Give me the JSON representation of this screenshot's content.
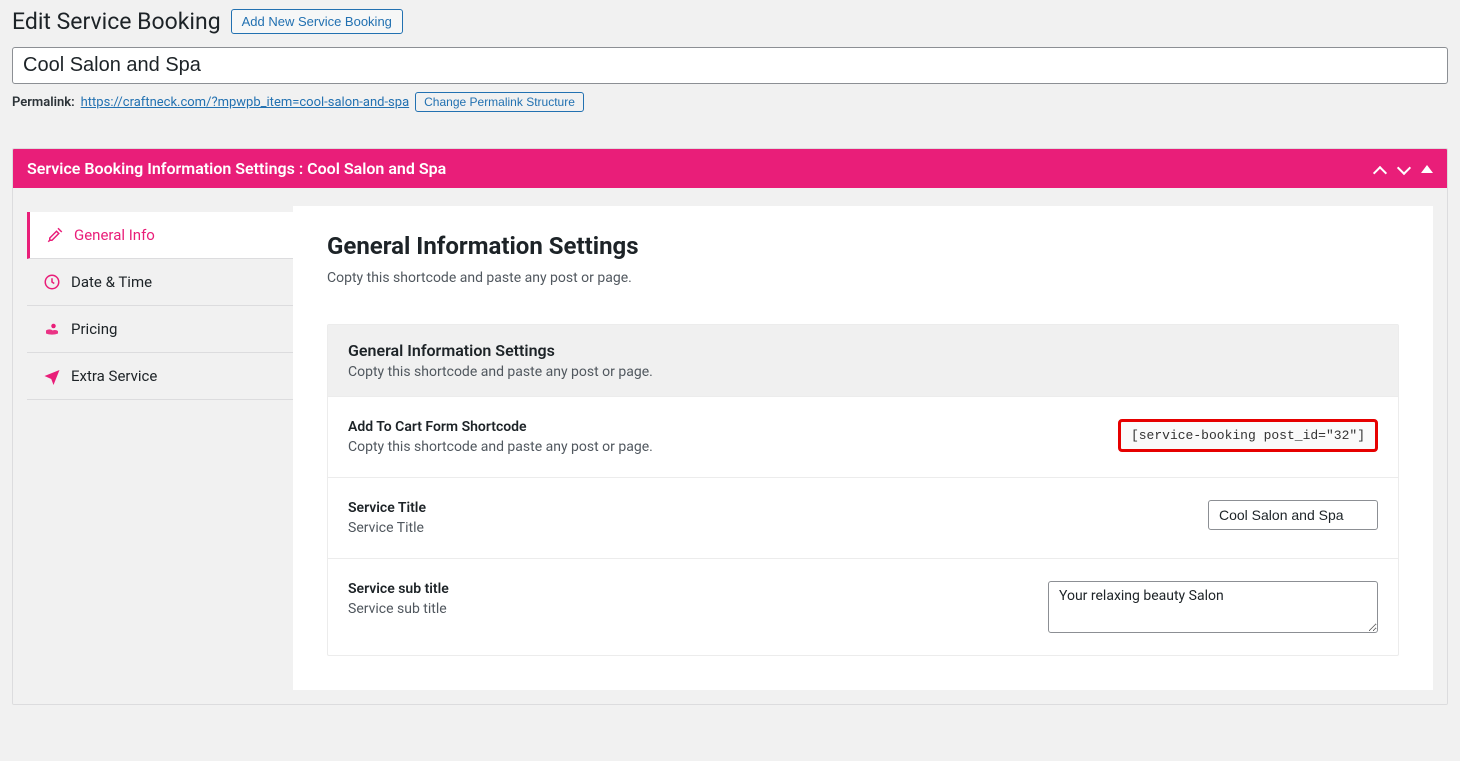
{
  "header": {
    "title": "Edit Service Booking",
    "add_new_label": "Add New Service Booking"
  },
  "post": {
    "title": "Cool Salon and Spa",
    "permalink_label": "Permalink:",
    "permalink_url": "https://craftneck.com/?mpwpb_item=cool-salon-and-spa",
    "change_permalink_label": "Change Permalink Structure"
  },
  "panel": {
    "title": "Service Booking Information Settings : Cool Salon and Spa"
  },
  "sidebar": {
    "items": [
      {
        "label": "General Info",
        "icon": "tools-icon"
      },
      {
        "label": "Date & Time",
        "icon": "clock-icon"
      },
      {
        "label": "Pricing",
        "icon": "hand-coin-icon"
      },
      {
        "label": "Extra Service",
        "icon": "airplane-icon"
      }
    ]
  },
  "main": {
    "heading": "General Information Settings",
    "sub": "Copty this shortcode and paste any post or page.",
    "section_head_title": "General Information Settings",
    "section_head_sub": "Copty this shortcode and paste any post or page.",
    "rows": {
      "shortcode": {
        "title": "Add To Cart Form Shortcode",
        "sub": "Copty this shortcode and paste any post or page.",
        "value": "[service-booking post_id=\"32\"]"
      },
      "service_title": {
        "title": "Service Title",
        "sub": "Service Title",
        "value": "Cool Salon and Spa"
      },
      "service_subtitle": {
        "title": "Service sub title",
        "sub": "Service sub title",
        "value": "Your relaxing beauty Salon"
      }
    }
  }
}
